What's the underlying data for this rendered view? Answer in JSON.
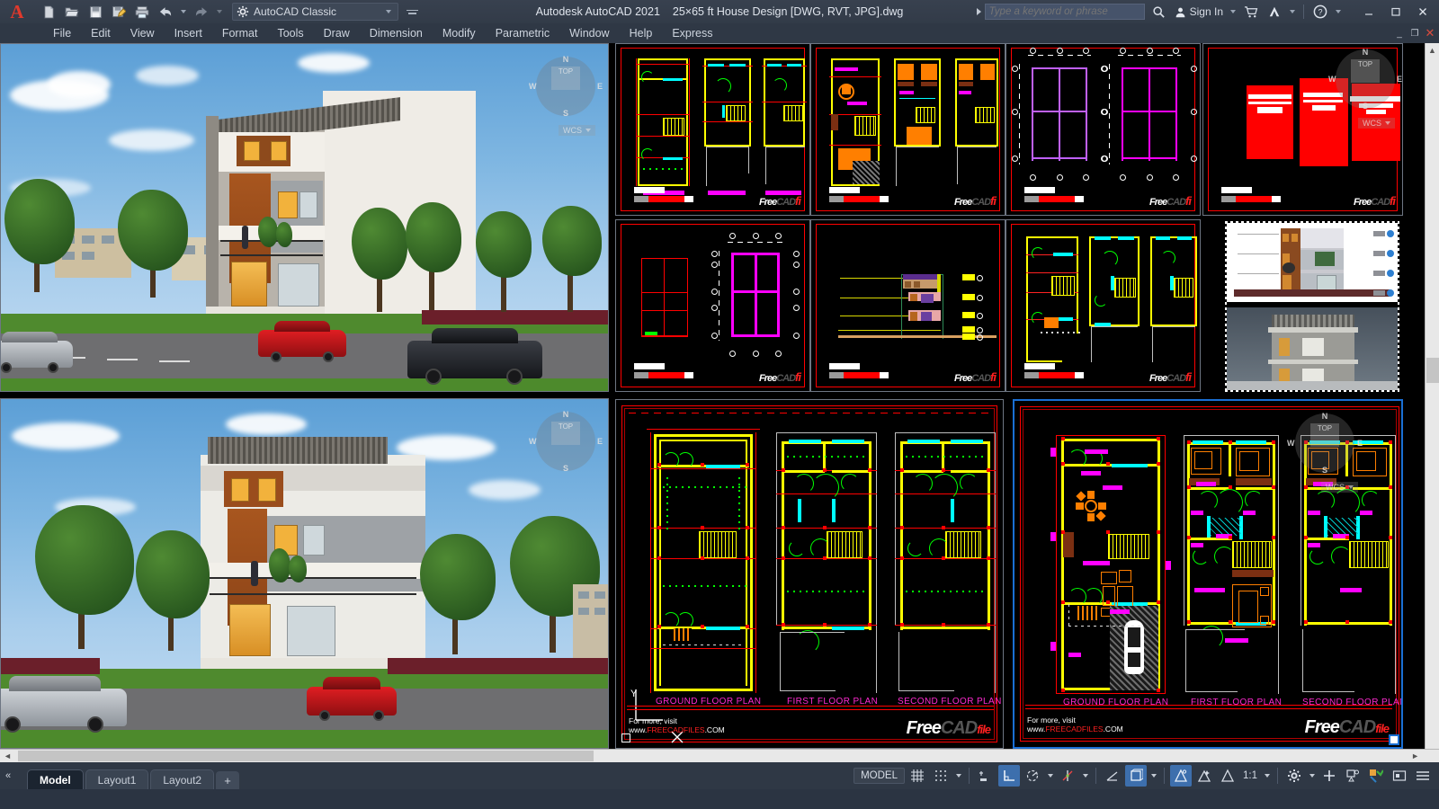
{
  "app": {
    "logo_letter": "A",
    "title_product": "Autodesk AutoCAD 2021",
    "title_document": "25×65 ft House Design [DWG, RVT, JPG].dwg"
  },
  "quick_access": {
    "items": [
      {
        "name": "new-file",
        "icon": "new-document-icon"
      },
      {
        "name": "open-file",
        "icon": "open-folder-icon"
      },
      {
        "name": "save",
        "icon": "save-disk-icon"
      },
      {
        "name": "save-as",
        "icon": "save-as-icon"
      },
      {
        "name": "plot",
        "icon": "printer-icon"
      },
      {
        "name": "undo",
        "icon": "undo-arrow-icon"
      },
      {
        "name": "redo",
        "icon": "redo-arrow-icon"
      }
    ],
    "workspace_label": "AutoCAD Classic"
  },
  "titlebar_right": {
    "search_placeholder": "Type a keyword or phrase",
    "search_value": "",
    "sign_in_label": "Sign In",
    "icons": [
      "search-icon",
      "user-icon",
      "cart-icon",
      "autodesk-a-icon",
      "help-icon"
    ],
    "window_buttons": [
      "minimize",
      "maximize",
      "close"
    ]
  },
  "menubar": {
    "items": [
      "File",
      "Edit",
      "View",
      "Insert",
      "Format",
      "Tools",
      "Draw",
      "Dimension",
      "Modify",
      "Parametric",
      "Window",
      "Help",
      "Express"
    ]
  },
  "viewports": {
    "render_top": {
      "name": "3d-render-front-right-view",
      "caption": "Exterior 3D render — three storey house, front-right perspective"
    },
    "render_bottom": {
      "name": "3d-render-front-view",
      "caption": "Exterior 3D render — three storey house, front elevation view"
    },
    "thumbs_row1": [
      {
        "name": "thumb-beam-layout-plans",
        "kind": "floor-plans"
      },
      {
        "name": "thumb-furnished-plans",
        "kind": "furnished-plans"
      },
      {
        "name": "thumb-column-grid-plans",
        "kind": "grid"
      },
      {
        "name": "thumb-3d-solid-massing",
        "kind": "massing"
      }
    ],
    "thumbs_row2": [
      {
        "name": "thumb-foundation-grid",
        "kind": "grid"
      },
      {
        "name": "thumb-section-elevation",
        "kind": "section"
      },
      {
        "name": "thumb-working-plans",
        "kind": "floor-plans"
      },
      {
        "name": "thumb-elevation-and-photo",
        "kind": "elevation-photo"
      }
    ],
    "main_left": {
      "name": "viewport-working-drawing",
      "plan_labels": [
        "GROUND FLOOR PLAN",
        "FIRST FLOOR PLAN",
        "SECOND FLOOR PLAN"
      ],
      "footer_line1": "For more, visit",
      "footer_line2_prefix": "www.",
      "footer_line2_brand": "FREECADFILES",
      "footer_line2_suffix": ".COM",
      "logo_free": "Free",
      "logo_cad": "CAD",
      "logo_file": "file"
    },
    "main_right": {
      "name": "viewport-furnished-drawing",
      "active": true,
      "plan_labels": [
        "GROUND FLOOR PLAN",
        "FIRST FLOOR PLAN",
        "SECOND FLOOR PLAN"
      ],
      "footer_line1": "For more, visit",
      "footer_line2_prefix": "www.",
      "footer_line2_brand": "FREECADFILES",
      "footer_line2_suffix": ".COM",
      "logo_free": "Free",
      "logo_cad": "CAD",
      "logo_file": "file",
      "navcube": {
        "top": "TOP",
        "n": "N",
        "s": "S",
        "e": "E",
        "w": "W",
        "ucs": "WCS"
      }
    }
  },
  "ucs_icon": {
    "y_label": "Y",
    "x_label": "X"
  },
  "layout_tabs": {
    "tabs": [
      "Model",
      "Layout1",
      "Layout2"
    ],
    "active": "Model",
    "add_label": "+"
  },
  "statusbar": {
    "model_label": "MODEL",
    "scale_label": "1:1",
    "items": [
      {
        "name": "grid-display-toggle",
        "icon": "grid-icon",
        "on": false
      },
      {
        "name": "snap-mode-toggle",
        "icon": "snap-dots-icon",
        "on": false
      },
      {
        "name": "infer-constraints",
        "icon": "infer-icon",
        "on": false
      },
      {
        "name": "ortho-mode-toggle",
        "icon": "ortho-icon",
        "on": true
      },
      {
        "name": "polar-tracking-toggle",
        "icon": "polar-icon",
        "on": false
      },
      {
        "name": "object-snap-toggle",
        "icon": "osnap-icon",
        "on": false
      },
      {
        "name": "object-snap-tracking",
        "icon": "otrack-icon",
        "on": false
      },
      {
        "name": "dynamic-ucs-toggle",
        "icon": "ucs-icon",
        "on": true
      },
      {
        "name": "annotation-visibility",
        "icon": "annotation-icon",
        "on": true
      },
      {
        "name": "auto-scale",
        "icon": "autoscale-icon",
        "on": false
      },
      {
        "name": "annotation-scale",
        "icon": "annoscale-icon",
        "on": false
      },
      {
        "name": "workspace-switching",
        "icon": "gear-icon",
        "on": false
      },
      {
        "name": "hardware-acceleration",
        "icon": "plus-icon",
        "on": false
      },
      {
        "name": "isolate-objects",
        "icon": "isolate-icon",
        "on": false
      },
      {
        "name": "clean-screen",
        "icon": "cleanscreen-icon",
        "on": false
      },
      {
        "name": "fullscreen-toggle",
        "icon": "fullscreen-icon",
        "on": false
      },
      {
        "name": "customization-menu",
        "icon": "hamburger-icon",
        "on": false
      }
    ]
  }
}
